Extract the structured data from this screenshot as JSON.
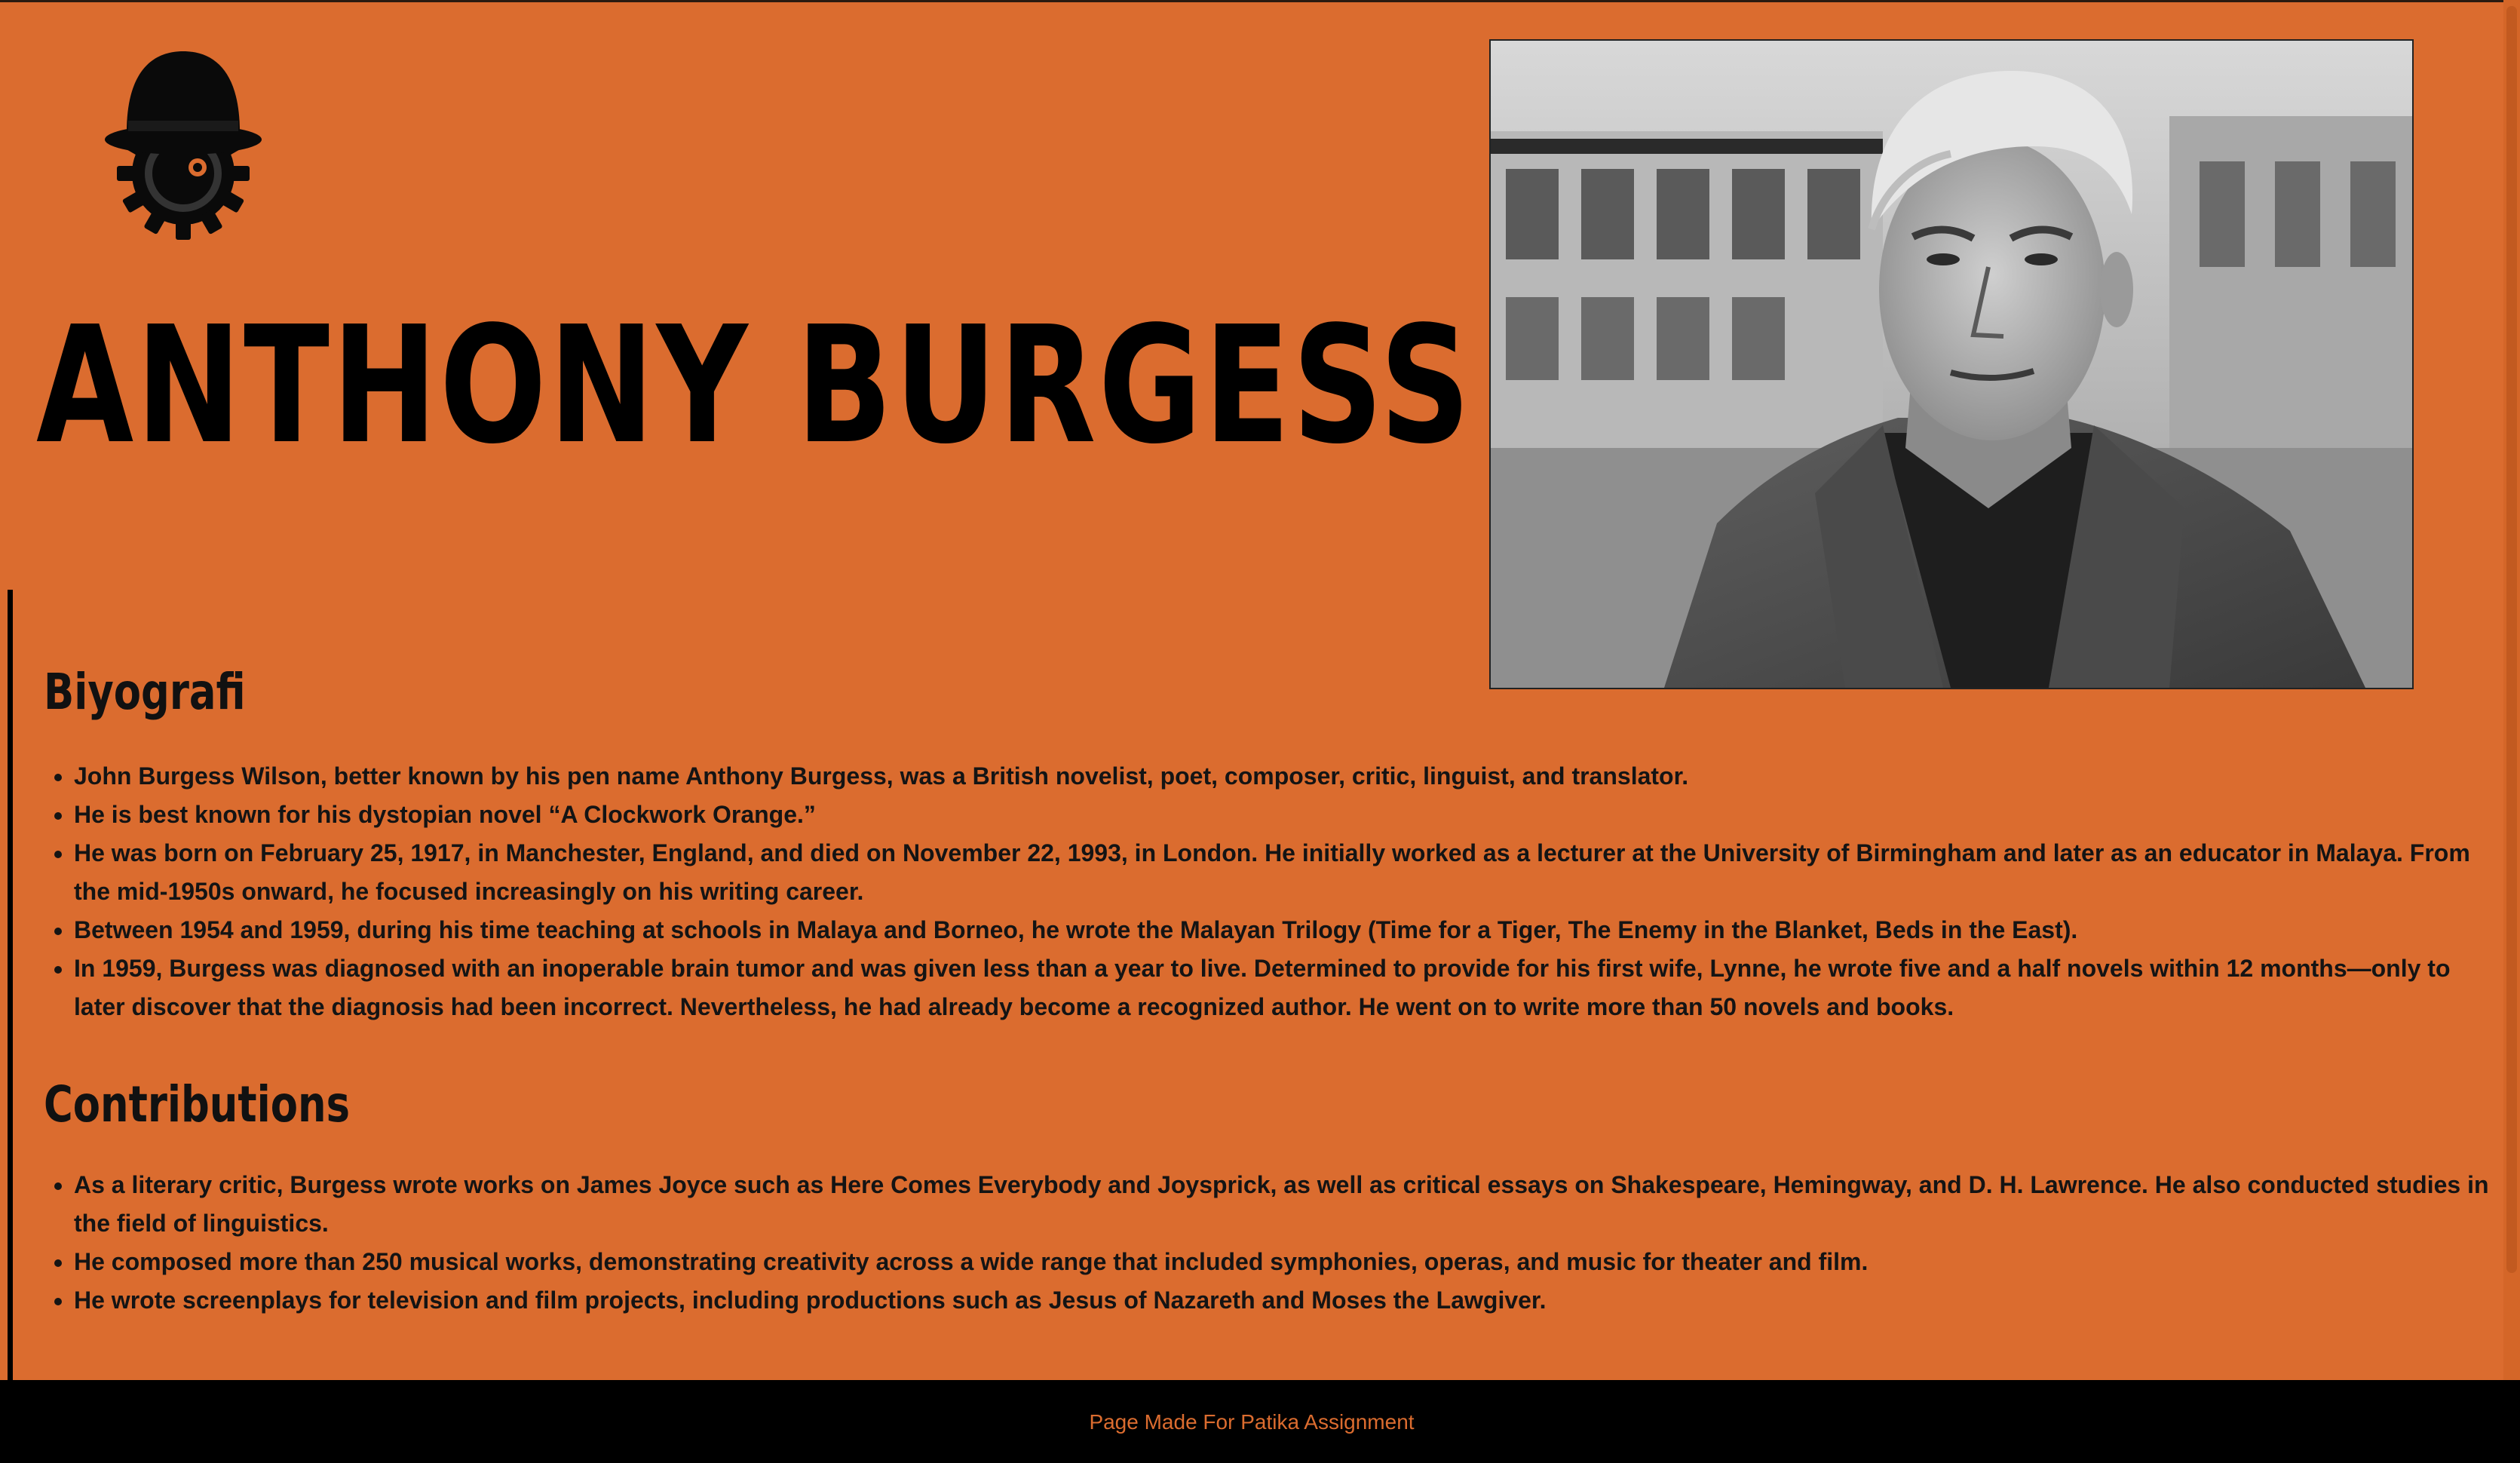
{
  "header": {
    "logo_icon": "bowler-hat-gear-icon",
    "title": "ANTHONY BURGESS"
  },
  "portrait": {
    "description_icon": "author-portrait-photo"
  },
  "biography": {
    "heading": "Biyografi",
    "items": [
      "John Burgess Wilson, better known by his pen name Anthony Burgess, was a British novelist, poet, composer, critic, linguist, and translator.",
      "He is best known for his dystopian novel “A Clockwork Orange.”",
      "He was born on February 25, 1917, in Manchester, England, and died on November 22, 1993, in London. He initially worked as a lecturer at the University of Birmingham and later as an educator in Malaya. From the mid-1950s onward, he focused increasingly on his writing career.",
      "Between 1954 and 1959, during his time teaching at schools in Malaya and Borneo, he wrote the Malayan Trilogy (Time for a Tiger, The Enemy in the Blanket, Beds in the East).",
      "In 1959, Burgess was diagnosed with an inoperable brain tumor and was given less than a year to live. Determined to provide for his first wife, Lynne, he wrote five and a half novels within 12 months—only to later discover that the diagnosis had been incorrect. Nevertheless, he had already become a recognized author. He went on to write more than 50 novels and books."
    ]
  },
  "contributions": {
    "heading": "Contributions",
    "items": [
      "As a literary critic, Burgess wrote works on James Joyce such as Here Comes Everybody and Joysprick, as well as critical essays on Shakespeare, Hemingway, and D. H. Lawrence. He also conducted studies in the field of linguistics.",
      "He composed more than 250 musical works, demonstrating creativity across a wide range that included symphonies, operas, and music for theater and film.",
      "He wrote screenplays for television and film projects, including productions such as Jesus of Nazareth and Moses the Lawgiver."
    ]
  },
  "footer": {
    "text": "Page Made For Patika Assignment"
  },
  "colors": {
    "background": "#DB6C2F",
    "text": "#111111",
    "footer_background": "#000000",
    "footer_text": "#DB6C2F"
  }
}
